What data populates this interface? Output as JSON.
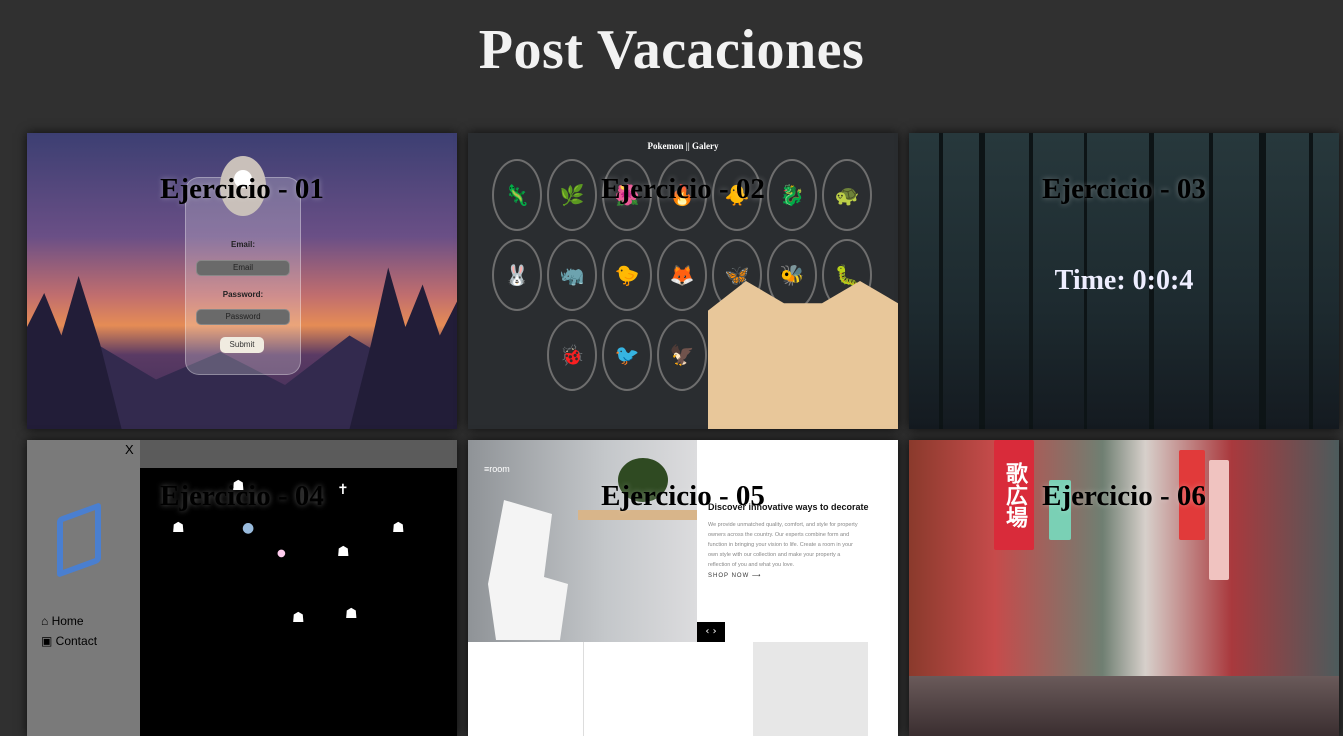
{
  "page": {
    "title": "Post Vacaciones"
  },
  "cards": [
    {
      "title": "Ejercicio - 01",
      "preview": {
        "email_label": "Email:",
        "email_placeholder": "Email",
        "password_label": "Password:",
        "password_placeholder": "Password",
        "submit_label": "Submit"
      }
    },
    {
      "title": "Ejercicio - 02",
      "preview": {
        "gallery_title": "Pokemon || Galery"
      }
    },
    {
      "title": "Ejercicio - 03",
      "preview": {
        "timer": "Time: 0:0:4"
      }
    },
    {
      "title": "Ejercicio - 04",
      "preview": {
        "close": "X",
        "links": [
          "Home",
          "Contact"
        ]
      }
    },
    {
      "title": "Ejercicio - 05",
      "preview": {
        "logo": "≡room",
        "heading": "Discover innovative ways to decorate",
        "body": "We provide unmatched quality, comfort, and style for property owners across the country. Our experts combine form and function in bringing your vision to life. Create a room in your own style with our collection and make your property a reflection of you and what you love.",
        "cta": "SHOP NOW ⟶"
      }
    },
    {
      "title": "Ejercicio - 06",
      "preview": {
        "sign_text": "歌広場"
      }
    }
  ],
  "colors": {
    "background": "#303030",
    "title": "#f2f2f2",
    "card_title": "#000000"
  }
}
